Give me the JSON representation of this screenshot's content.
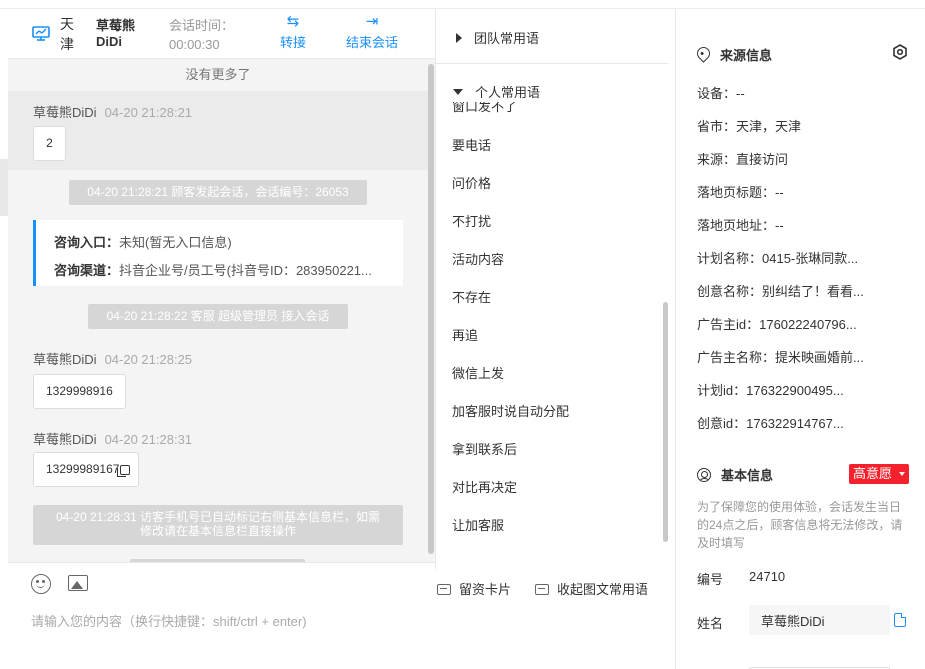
{
  "header": {
    "city": "天津",
    "visitor_name": "草莓熊DiDi",
    "session_time_label": "会话时间：",
    "session_time_value": "00:00:30",
    "transfer_label": "转接",
    "end_session_label": "结束会话"
  },
  "messages": {
    "no_more": "没有更多了",
    "msg1": {
      "sender": "草莓熊DiDi",
      "time": "04-20 21:28:21",
      "text": "2"
    },
    "sys1": "04-20 21:28:21 顾客发起会话，会话编号：26053",
    "info_card": {
      "entry_label": "咨询入口：",
      "entry_value": "未知(暂无入口信息)",
      "channel_label": "咨询渠道：",
      "channel_value": "抖音企业号/员工号(抖音号ID：283950221..."
    },
    "sys2": "04-20 21:28:22 客服 超级管理员 接入会话",
    "msg2": {
      "sender": "草莓熊DiDi",
      "time": "04-20 21:28:25",
      "text": "1329998916"
    },
    "msg3": {
      "sender": "草莓熊DiDi",
      "time": "04-20 21:28:31",
      "text": "13299989167"
    },
    "sys3_line1": "04-20 21:28:31 访客手机号已自动标记右侧基本信息栏，如需",
    "sys3_line2": "修改请在基本信息栏直接操作"
  },
  "input": {
    "placeholder": "请输入您的内容（换行快捷键：shift/ctrl + enter)",
    "lead_card_label": "留资卡片",
    "collapse_label": "收起图文常用语"
  },
  "phrases": {
    "team_label": "团队常用语",
    "personal_label": "个人常用语",
    "items": [
      "窗口发不了",
      "要电话",
      "问价格",
      "不打扰",
      "活动内容",
      "不存在",
      "再追",
      "微信上发",
      "加客服时说自动分配",
      "拿到联系后",
      "对比再决定",
      "让加客服"
    ]
  },
  "source": {
    "title": "来源信息",
    "rows": [
      "设备：--",
      "省市：天津，天津",
      "来源：直接访问",
      "落地页标题：--",
      "落地页地址：--",
      "计划名称：0415-张琳同款...",
      "创意名称：别纠结了！看看...",
      "广告主id：176022240796...",
      "广告主名称：提米映画婚前...",
      "计划id：176322900495...",
      "创意id：176322914767..."
    ]
  },
  "basic": {
    "title": "基本信息",
    "intent_badge": "高意愿",
    "notice": "为了保障您的使用体验，会话发生当日的24点之后，顾客信息将无法修改，请及时填写",
    "id_label": "编号",
    "id_value": "24710",
    "name_label": "姓名",
    "name_value": "草莓熊DiDi"
  },
  "colors": {
    "accent": "#1890ff",
    "badge": "#f5222d",
    "chat_bg": "#f4f4f4",
    "system_msg_bg": "#d6d6d6"
  }
}
